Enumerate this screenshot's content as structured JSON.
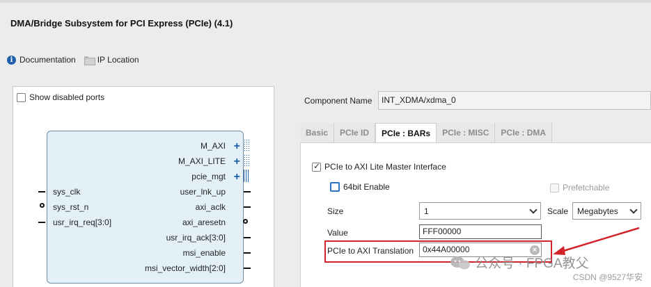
{
  "header": {
    "title": "DMA/Bridge Subsystem for PCI Express (PCIe) (4.1)"
  },
  "toolbar": {
    "documentation_label": "Documentation",
    "ip_location_label": "IP Location"
  },
  "symbol_panel": {
    "show_disabled_ports_label": "Show disabled ports",
    "right_ports": [
      "M_AXI",
      "M_AXI_LITE",
      "pcie_mgt",
      "user_lnk_up",
      "axi_aclk",
      "axi_aresetn",
      "usr_irq_ack[3:0]",
      "msi_enable",
      "msi_vector_width[2:0]"
    ],
    "left_ports": [
      "sys_clk",
      "sys_rst_n",
      "usr_irq_req[3:0]"
    ]
  },
  "component": {
    "label": "Component Name",
    "value": "INT_XDMA/xdma_0"
  },
  "tabs": [
    {
      "label": "Basic"
    },
    {
      "label": "PCIe ID"
    },
    {
      "label": "PCIe : BARs"
    },
    {
      "label": "PCIe : MISC"
    },
    {
      "label": "PCIe : DMA"
    }
  ],
  "bars": {
    "lite_master_label": "PCIe to AXI Lite Master Interface",
    "enable64_label": "64bit Enable",
    "prefetchable_label": "Prefetchable",
    "size_label": "Size",
    "size_value": "1",
    "scale_label": "Scale",
    "scale_value": "Megabytes",
    "value_label": "Value",
    "value_value": "FFF00000",
    "translation_label": "PCIe to AXI Translation",
    "translation_value": "0x44A00000"
  },
  "watermark": {
    "text": "公众号 · FPGA教父",
    "csdn": "CSDN @9527华安"
  },
  "colors": {
    "highlight": "#d2232a",
    "accent": "#1f5ea8",
    "block_fill": "#e3f0f8"
  }
}
